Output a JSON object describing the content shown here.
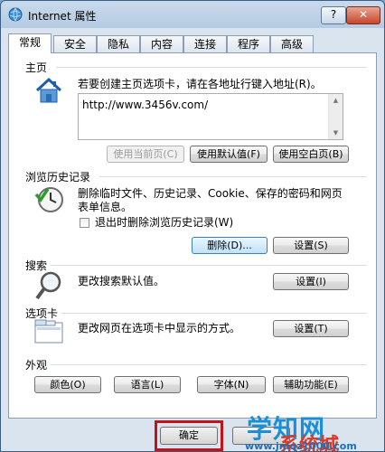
{
  "window": {
    "title": "Internet 属性",
    "help_label": "?",
    "close_label": "✕"
  },
  "tabs": [
    "常规",
    "安全",
    "隐私",
    "内容",
    "连接",
    "程序",
    "高级"
  ],
  "home": {
    "section": "主页",
    "description": "若要创建主页选项卡，请在各地址行键入地址(R)。",
    "url": "http://www.3456v.com/",
    "btn_current": "使用当前页(C)",
    "btn_default": "使用默认值(F)",
    "btn_blank": "使用空白页(B)"
  },
  "history": {
    "section": "浏览历史记录",
    "description_line1": "删除临时文件、历史记录、Cookie、保存的密码和网页",
    "description_line2": "表单信息。",
    "checkbox_label": "退出时删除浏览历史记录(W)",
    "btn_delete": "删除(D)...",
    "btn_settings": "设置(S)"
  },
  "search": {
    "section": "搜索",
    "description": "更改搜索默认值。",
    "btn_settings": "设置(I)"
  },
  "tabs_section": {
    "section": "选项卡",
    "description": "更改网页在选项卡中显示的方式。",
    "btn_settings": "设置(T)"
  },
  "appearance": {
    "section": "外观",
    "btn_colors": "颜色(O)",
    "btn_languages": "语言(L)",
    "btn_fonts": "字体(N)",
    "btn_accessibility": "辅助功能(E)"
  },
  "footer": {
    "btn_ok": "确定"
  },
  "watermark": {
    "main": "学知网",
    "sub": "系统城",
    "url": "www.jmqz1000.com"
  }
}
